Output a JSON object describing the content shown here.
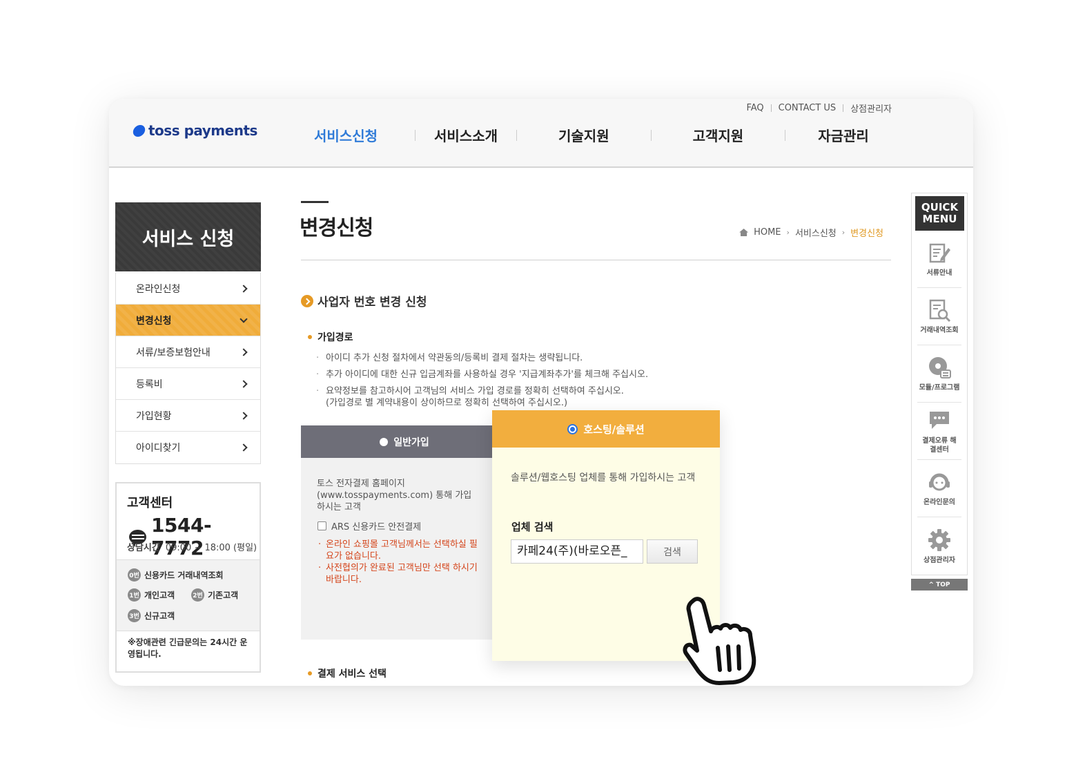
{
  "brand": {
    "name": "toss payments",
    "accent": "#f0ac3a",
    "brand_blue": "#1a5fe0"
  },
  "util_nav": [
    "FAQ",
    "CONTACT US",
    "상점관리자"
  ],
  "gnb": [
    {
      "label": "서비스신청",
      "active": true
    },
    {
      "label": "서비스소개",
      "active": false
    },
    {
      "label": "기술지원",
      "active": false
    },
    {
      "label": "고객지원",
      "active": false
    },
    {
      "label": "자금관리",
      "active": false
    }
  ],
  "sidebar": {
    "title": "서비스 신청",
    "items": [
      {
        "label": "온라인신청",
        "active": false
      },
      {
        "label": "변경신청",
        "active": true
      },
      {
        "label": "서류/보증보험안내",
        "active": false
      },
      {
        "label": "등록비",
        "active": false
      },
      {
        "label": "가입현황",
        "active": false
      },
      {
        "label": "아이디찾기",
        "active": false
      }
    ]
  },
  "customer_center": {
    "title": "고객센터",
    "phone": "1544-7772",
    "hours_label": "상담시간",
    "hours": "09:00 ~ 18:00 (평일)",
    "ars": [
      {
        "num": "0번",
        "label": "신용카드 거래내역조회"
      },
      {
        "num": "1번",
        "label": "개인고객"
      },
      {
        "num": "2번",
        "label": "기존고객"
      },
      {
        "num": "3번",
        "label": "신규고객"
      }
    ],
    "note": "※장애관련 긴급문의는 24시간 운영됩니다."
  },
  "page": {
    "title": "변경신청",
    "breadcrumb": [
      "HOME",
      "서비스신청",
      "변경신청"
    ],
    "section_title": "사업자 번호 변경 신청",
    "signup_path": {
      "title": "가입경로",
      "bullets": [
        "아이디 추가 신청 절차에서 약관동의/등록비 결제 절차는 생략됩니다.",
        "추가 아이디에 대한 신규 입금계좌를 사용하실 경우 '지급계좌추가'를 체크해 주십시오.",
        "요약정보를 참고하시어 고객님의 서비스 가입 경로를 정확히 선택하여 주십시오."
      ],
      "bullet_cont": "(가입경로 별 계약내용이 상이하므로 정확히 선택하여 주십시오.)"
    },
    "option_general": {
      "label": "일반가입",
      "desc": "토스 전자결제 홈페이지 (www.tosspayments.com) 통해 가입하시는 고객",
      "ars_checkbox": "ARS 신용카드 안전결제",
      "warnings": [
        "온라인 쇼핑몰 고객님께서는 선택하실 필요가 없습니다.",
        "사전협의가 완료된 고객님만 선택 하시기 바랍니다."
      ]
    },
    "option_hosting": {
      "label": "호스팅/솔루션",
      "desc": "솔루션/웹호스팅 업체를 통해 가입하시는 고객",
      "search_label": "업체 검색",
      "search_value": "카페24(주)(바로오픈_",
      "search_button": "검색"
    },
    "payment_service_title": "결제 서비스 선택"
  },
  "quick_menu": {
    "title": "QUICK MENU",
    "items": [
      {
        "label": "서류안내",
        "icon": "document-edit-icon"
      },
      {
        "label": "거래내역조회",
        "icon": "document-search-icon"
      },
      {
        "label": "모듈/프로그램",
        "icon": "disc-install-icon"
      },
      {
        "label": "결제오류 해결센터",
        "icon": "chat-bubble-icon"
      },
      {
        "label": "온라인문의",
        "icon": "headset-icon"
      },
      {
        "label": "상점관리자",
        "icon": "gear-icon"
      }
    ],
    "top_label": "TOP"
  }
}
